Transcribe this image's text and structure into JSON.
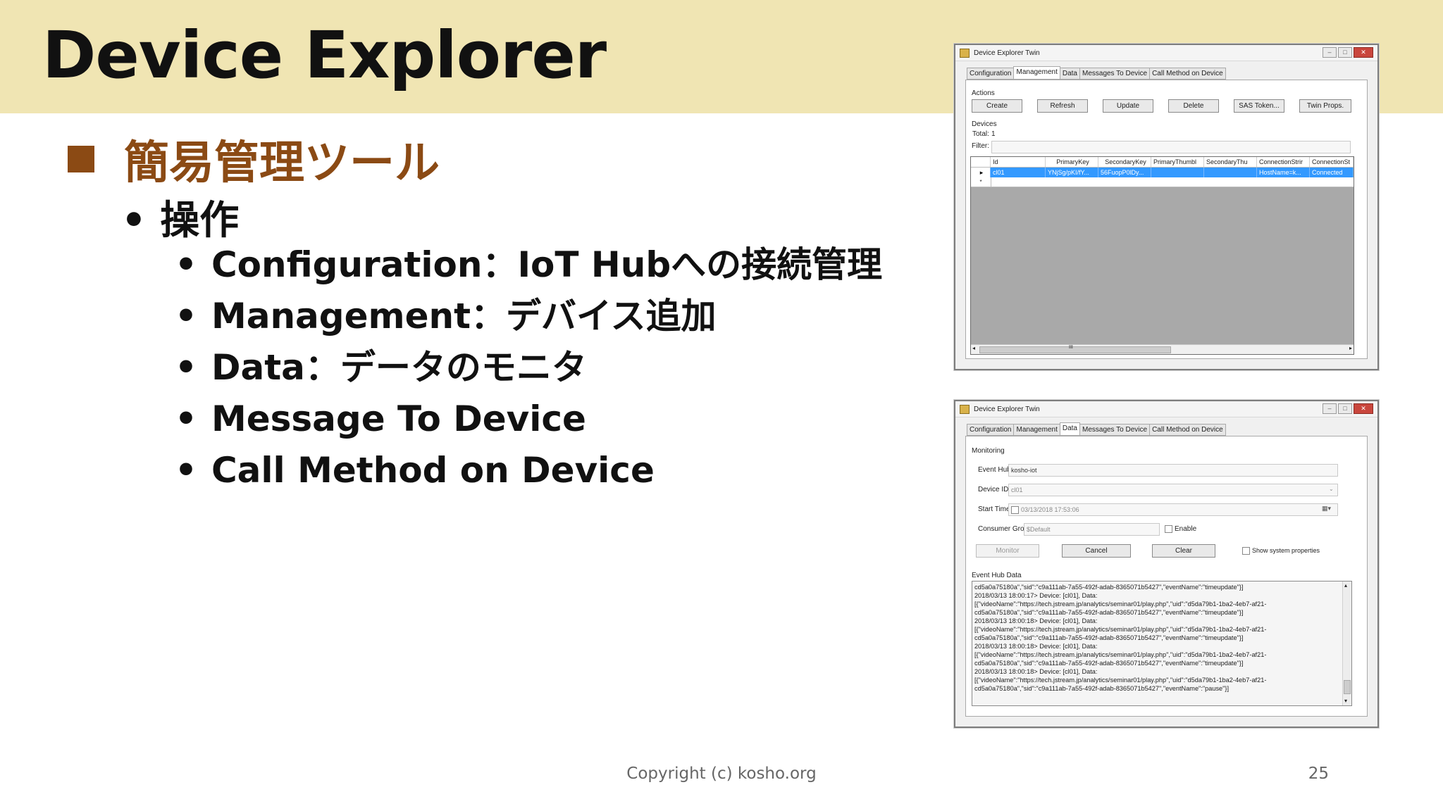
{
  "slide": {
    "title": "Device Explorer",
    "heading": "簡易管理ツール",
    "subheading": "操作",
    "bullets": [
      "Configuration：IoT Hubへの接続管理",
      "Management：デバイス追加",
      "Data：データのモニタ",
      "Message To Device",
      "Call Method on Device"
    ],
    "footer": "Copyright (c) kosho.org",
    "page_number": "25"
  },
  "colors": {
    "header_band": "#f0e5b3",
    "accent": "#8b4a14",
    "selection": "#3399ff"
  },
  "window_management": {
    "title": "Device Explorer Twin",
    "tabs": [
      "Configuration",
      "Management",
      "Data",
      "Messages To Device",
      "Call Method on Device"
    ],
    "active_tab": "Management",
    "actions_label": "Actions",
    "buttons": [
      "Create",
      "Refresh",
      "Update",
      "Delete",
      "SAS Token...",
      "Twin Props."
    ],
    "devices_label": "Devices",
    "total_label": "Total:",
    "total_value": "1",
    "filter_label": "Filter:",
    "columns": [
      "Id",
      "PrimaryKey",
      "SecondaryKey",
      "PrimaryThumbl",
      "SecondaryThu",
      "ConnectionStrir",
      "ConnectionSt"
    ],
    "row": [
      "cl01",
      "YNjSg/pKI/fY...",
      "56FuopP0lDy...",
      "",
      "",
      "HostName=k...",
      "Connected"
    ],
    "scroll_mark": "III"
  },
  "window_data": {
    "title": "Device Explorer Twin",
    "tabs": [
      "Configuration",
      "Management",
      "Data",
      "Messages To Device",
      "Call Method on Device"
    ],
    "active_tab": "Data",
    "monitoring_label": "Monitoring",
    "event_hub_label": "Event Hub:",
    "event_hub_value": "kosho-iot",
    "device_id_label": "Device ID:",
    "device_id_value": "cl01",
    "start_time_label": "Start Time:",
    "start_time_value": "03/13/2018 17:53:06",
    "consumer_group_label": "Consumer Group:",
    "consumer_group_value": "$Default",
    "enable_label": "Enable",
    "monitor_button": "Monitor",
    "cancel_button": "Cancel",
    "clear_button": "Clear",
    "show_system_label": "Show system properties",
    "event_hub_data_label": "Event Hub Data",
    "log_lines": [
      "cd5a0a75180a\",\"sid\":\"c9a111ab-7a55-492f-adab-8365071b5427\",\"eventName\":\"timeupdate\"}]",
      "2018/03/13 18:00:17> Device: [cl01], Data:",
      "[{\"videoName\":\"https://tech.jstream.jp/analytics/seminar01/play.php\",\"uid\":\"d5da79b1-1ba2-4eb7-af21-",
      "cd5a0a75180a\",\"sid\":\"c9a111ab-7a55-492f-adab-8365071b5427\",\"eventName\":\"timeupdate\"}]",
      "2018/03/13 18:00:18> Device: [cl01], Data:",
      "[{\"videoName\":\"https://tech.jstream.jp/analytics/seminar01/play.php\",\"uid\":\"d5da79b1-1ba2-4eb7-af21-",
      "cd5a0a75180a\",\"sid\":\"c9a111ab-7a55-492f-adab-8365071b5427\",\"eventName\":\"timeupdate\"}]",
      "2018/03/13 18:00:18> Device: [cl01], Data:",
      "[{\"videoName\":\"https://tech.jstream.jp/analytics/seminar01/play.php\",\"uid\":\"d5da79b1-1ba2-4eb7-af21-",
      "cd5a0a75180a\",\"sid\":\"c9a111ab-7a55-492f-adab-8365071b5427\",\"eventName\":\"timeupdate\"}]",
      "2018/03/13 18:00:18> Device: [cl01], Data:",
      "[{\"videoName\":\"https://tech.jstream.jp/analytics/seminar01/play.php\",\"uid\":\"d5da79b1-1ba2-4eb7-af21-",
      "cd5a0a75180a\",\"sid\":\"c9a111ab-7a55-492f-adab-8365071b5427\",\"eventName\":\"pause\"}]"
    ]
  }
}
